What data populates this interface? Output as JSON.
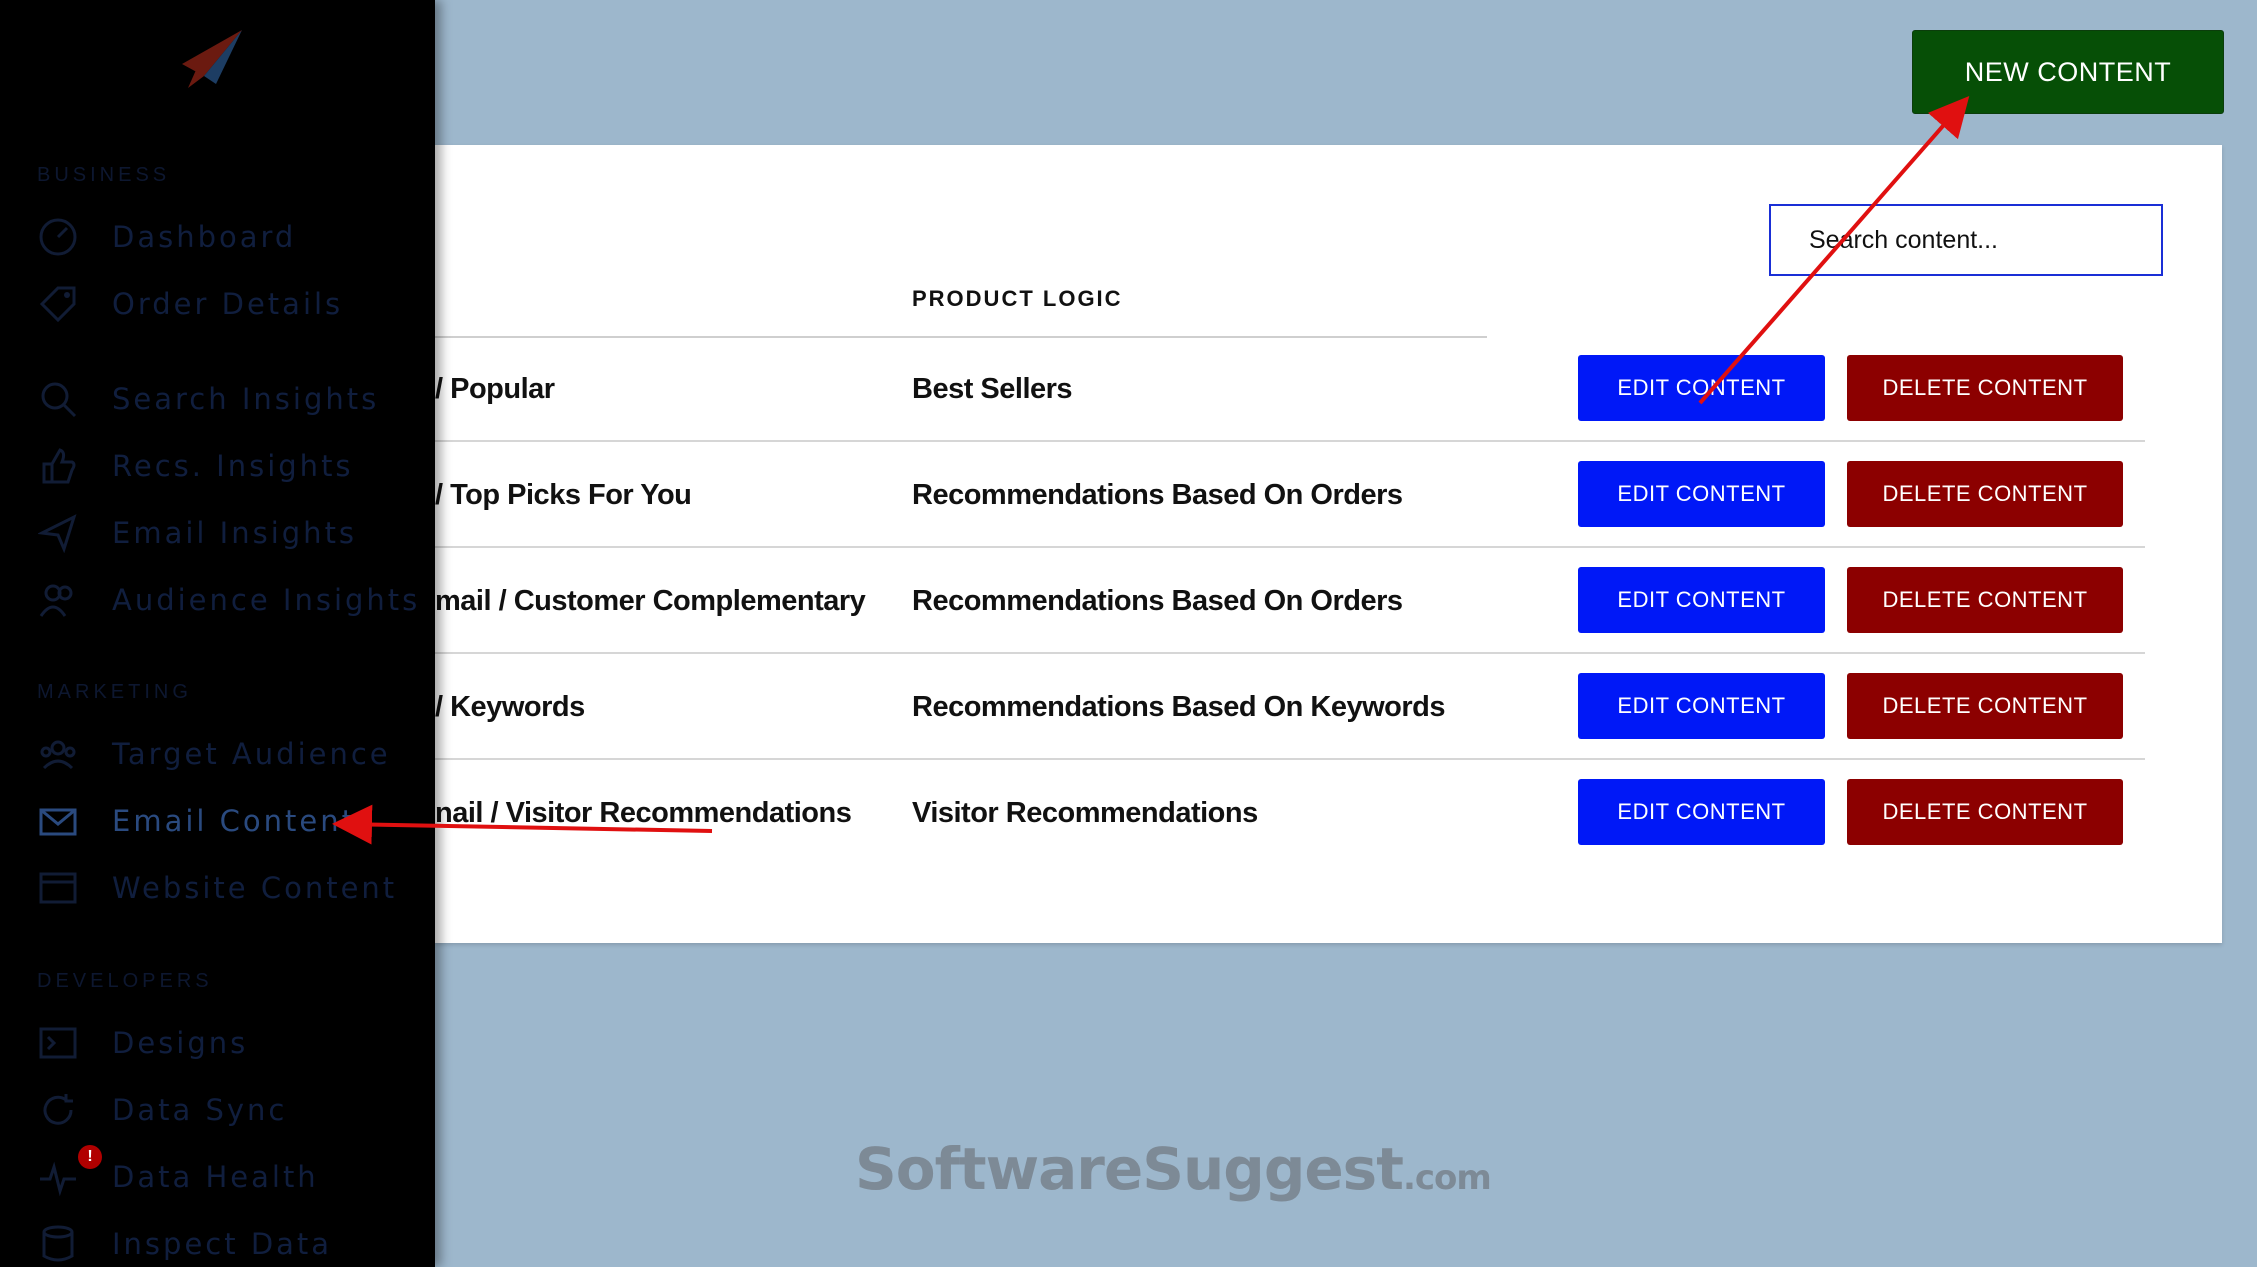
{
  "sidebar": {
    "sections": [
      {
        "label": "BUSINESS",
        "items": [
          {
            "label": "Dashboard",
            "icon": "dashboard-gauge-icon"
          },
          {
            "label": "Order Details",
            "icon": "tag-icon"
          },
          {
            "label": "Search Insights",
            "icon": "magnifier-icon"
          },
          {
            "label": "Recs. Insights",
            "icon": "thumbs-up-icon"
          },
          {
            "label": "Email Insights",
            "icon": "paper-plane-icon"
          },
          {
            "label": "Audience Insights",
            "icon": "users-icon"
          }
        ]
      },
      {
        "label": "MARKETING",
        "items": [
          {
            "label": "Target Audience",
            "icon": "audience-icon"
          },
          {
            "label": "Email Content",
            "icon": "envelope-icon",
            "active": true
          },
          {
            "label": "Website Content",
            "icon": "browser-icon"
          }
        ]
      },
      {
        "label": "DEVELOPERS",
        "items": [
          {
            "label": "Designs",
            "icon": "terminal-icon"
          },
          {
            "label": "Data Sync",
            "icon": "sync-icon"
          },
          {
            "label": "Data Health",
            "icon": "pulse-icon",
            "badge": "!"
          },
          {
            "label": "Inspect Data",
            "icon": "database-icon"
          }
        ]
      }
    ]
  },
  "header": {
    "new_content_label": "NEW CONTENT"
  },
  "search": {
    "placeholder": "Search content...",
    "value": ""
  },
  "table": {
    "column_header": "PRODUCT LOGIC",
    "rows": [
      {
        "name": "/ Popular",
        "logic": "Best Sellers"
      },
      {
        "name": "/ Top Picks For You",
        "logic": "Recommendations Based On Orders"
      },
      {
        "name": "mail / Customer Complementary",
        "logic": "Recommendations Based On Orders"
      },
      {
        "name": "/ Keywords",
        "logic": "Recommendations Based On Keywords"
      },
      {
        "name": "nail / Visitor Recommendations",
        "logic": "Visitor Recommendations"
      }
    ],
    "edit_label": "EDIT CONTENT",
    "delete_label": "DELETE CONTENT"
  },
  "watermark": {
    "main": "SoftwareSuggest",
    "suffix": ".com"
  },
  "colors": {
    "new_content": "#064f06",
    "edit": "#0018f7",
    "delete": "#8c0000",
    "annotation_arrow": "#e01010"
  }
}
